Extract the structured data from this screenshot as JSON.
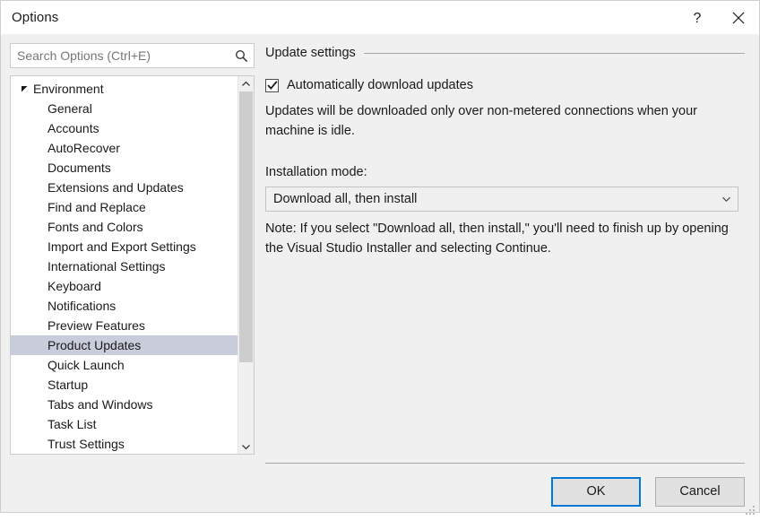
{
  "window": {
    "title": "Options",
    "help_icon": "question-mark-icon",
    "close_icon": "close-icon"
  },
  "search": {
    "placeholder": "Search Options (Ctrl+E)",
    "value": "",
    "icon": "search-icon"
  },
  "tree": {
    "root": {
      "label": "Environment",
      "expanded": true
    },
    "items": [
      {
        "label": "General",
        "selected": false
      },
      {
        "label": "Accounts",
        "selected": false
      },
      {
        "label": "AutoRecover",
        "selected": false
      },
      {
        "label": "Documents",
        "selected": false
      },
      {
        "label": "Extensions and Updates",
        "selected": false
      },
      {
        "label": "Find and Replace",
        "selected": false
      },
      {
        "label": "Fonts and Colors",
        "selected": false
      },
      {
        "label": "Import and Export Settings",
        "selected": false
      },
      {
        "label": "International Settings",
        "selected": false
      },
      {
        "label": "Keyboard",
        "selected": false
      },
      {
        "label": "Notifications",
        "selected": false
      },
      {
        "label": "Preview Features",
        "selected": false
      },
      {
        "label": "Product Updates",
        "selected": true
      },
      {
        "label": "Quick Launch",
        "selected": false
      },
      {
        "label": "Startup",
        "selected": false
      },
      {
        "label": "Tabs and Windows",
        "selected": false
      },
      {
        "label": "Task List",
        "selected": false
      },
      {
        "label": "Trust Settings",
        "selected": false
      }
    ],
    "scrollbar": {
      "up_icon": "chevron-up-icon",
      "down_icon": "chevron-down-icon",
      "thumb_height_percent": 78
    },
    "selection_color": "#c9ccdb"
  },
  "panel": {
    "group_title": "Update settings",
    "auto_download": {
      "label": "Automatically download updates",
      "checked": true
    },
    "description": "Updates will be downloaded only over non-metered connections when your machine is idle.",
    "installation_mode_label": "Installation mode:",
    "installation_mode_value": "Download all, then install",
    "installation_mode_arrow_icon": "chevron-down-icon",
    "note": "Note: If you select \"Download all, then install,\" you'll need to finish up by opening the Visual Studio Installer and selecting Continue."
  },
  "footer": {
    "ok_label": "OK",
    "cancel_label": "Cancel",
    "resize_grip_icon": "resize-grip-icon"
  },
  "colors": {
    "accent": "#0078d7",
    "dialog_bg": "#f0f0f0",
    "selection": "#c9ccdb"
  }
}
